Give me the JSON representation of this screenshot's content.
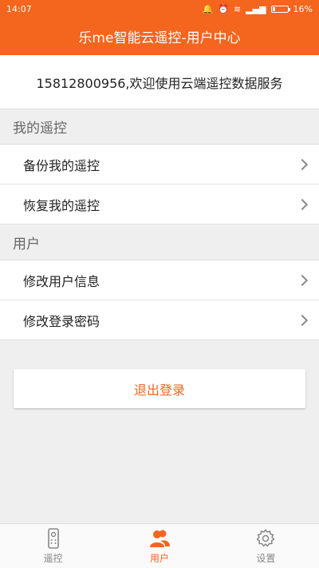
{
  "statusbar": {
    "time": "14:07",
    "battery": "16%",
    "battery_level": 0.16
  },
  "appbar": {
    "title": "乐me智能云遥控-用户中心"
  },
  "welcome": {
    "text": "15812800956,欢迎使用云端遥控数据服务"
  },
  "sections": {
    "remote": {
      "title": "我的遥控",
      "items": [
        {
          "label": "备份我的遥控"
        },
        {
          "label": "恢复我的遥控"
        }
      ]
    },
    "user": {
      "title": "用户",
      "items": [
        {
          "label": "修改用户信息"
        },
        {
          "label": "修改登录密码"
        }
      ]
    }
  },
  "logout": {
    "label": "退出登录"
  },
  "bottomnav": {
    "items": [
      {
        "label": "遥控",
        "icon": "remote-icon"
      },
      {
        "label": "用户",
        "icon": "users-icon",
        "active": true
      },
      {
        "label": "设置",
        "icon": "gear-icon"
      }
    ]
  },
  "colors": {
    "accent": "#f4651e",
    "background": "#efefef"
  }
}
